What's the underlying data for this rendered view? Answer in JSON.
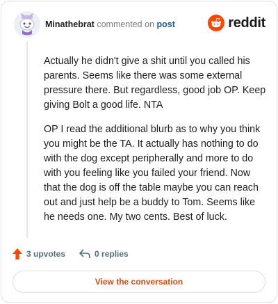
{
  "comment": {
    "username": "Minathebrat",
    "action_text": "commented on",
    "post_link": "post",
    "paragraphs": [
      "Actually he didn't give a shit until you called his parents. Seems like there was some external pressure there. But regardless, good job OP. Keep giving Bolt a good life. NTA",
      "OP I read the additional blurb as to why you think you might be the TA. It actually has nothing to do with the dog except peripherally and more to do with you feeling like you failed your friend. Now that the dog is off the table maybe you can reach out and just help be a buddy to Tom. Seems like he needs one. My two cents. Best of luck."
    ]
  },
  "brand": {
    "wordmark": "reddit",
    "icon": "reddit-logo-icon",
    "color": "#ff4500"
  },
  "stats": {
    "upvotes_label": "3 upvotes",
    "replies_label": "0 replies",
    "upvote_icon": "arrow-up-icon",
    "reply_icon": "reply-arrow-icon",
    "upvote_color": "#ff4500"
  },
  "cta": {
    "label": "View the conversation",
    "color": "#d24b12"
  }
}
